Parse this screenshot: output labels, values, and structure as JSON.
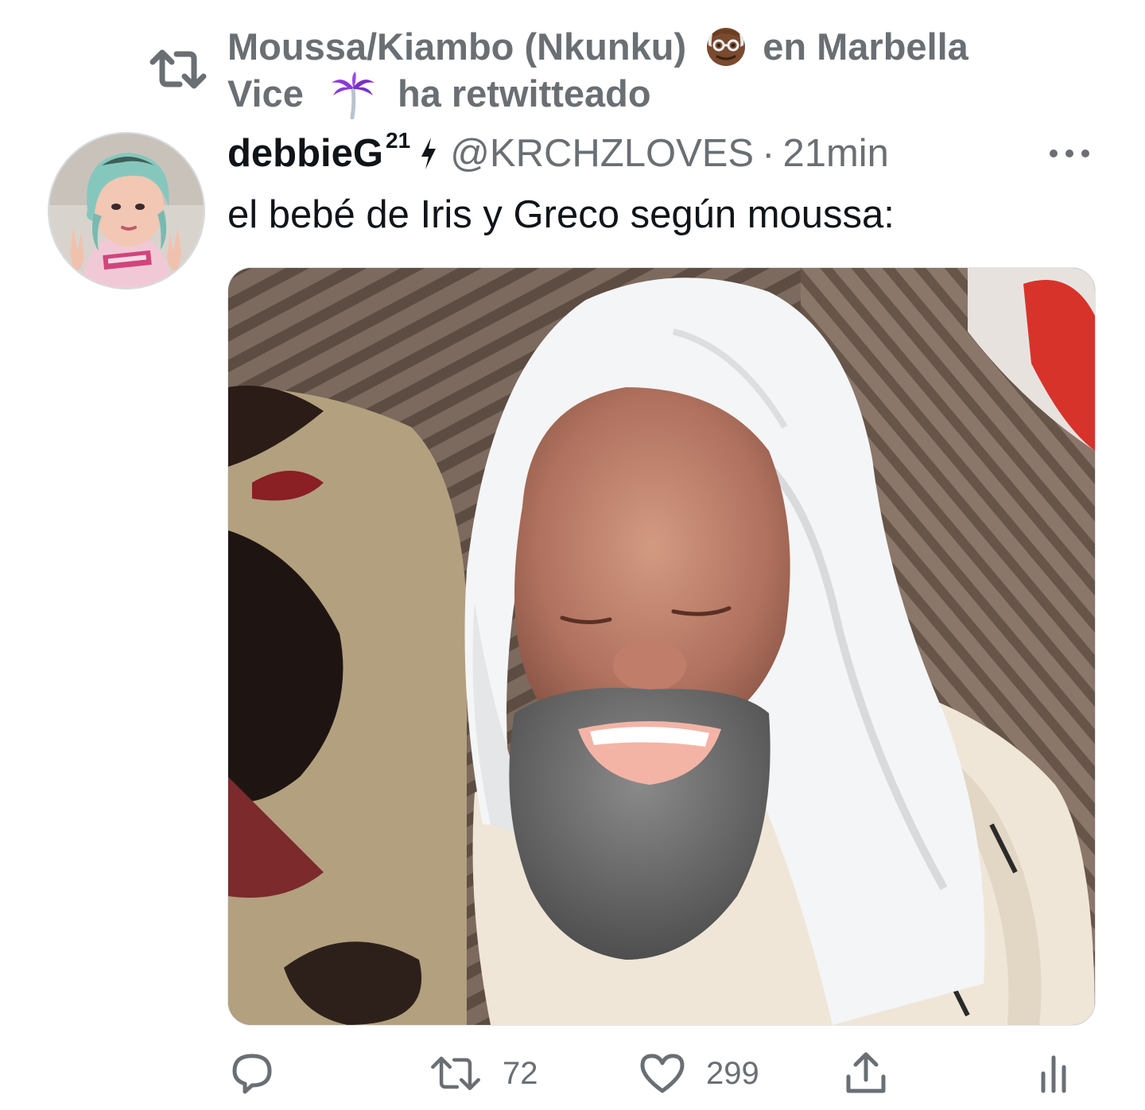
{
  "retweet_context": {
    "name_part": "Moussa/Kiambo (Nkunku)",
    "face_emoji_icon": "old-man-emoji-icon",
    "location_part_1": "en Marbella",
    "location_part_2": "Vice",
    "palm_emoji_icon": "palm-tree-emoji-icon",
    "action_text": "ha retwitteado"
  },
  "tweet": {
    "display_name": "debbieG",
    "name_superscript": "21",
    "handle": "@KRCHZLOVES",
    "separator": "·",
    "time": "21min",
    "text": "el bebé de Iris y Greco según moussa:",
    "media_description_icon": "meme-photo"
  },
  "actions": {
    "reply_icon": "reply-icon",
    "retweet_icon": "retweet-icon",
    "retweet_count": "72",
    "like_icon": "heart-icon",
    "like_count": "299",
    "share_icon": "share-icon",
    "analytics_icon": "analytics-icon"
  },
  "colors": {
    "text_primary": "#0f1419",
    "text_secondary": "#6a6f74",
    "background": "#ffffff"
  }
}
